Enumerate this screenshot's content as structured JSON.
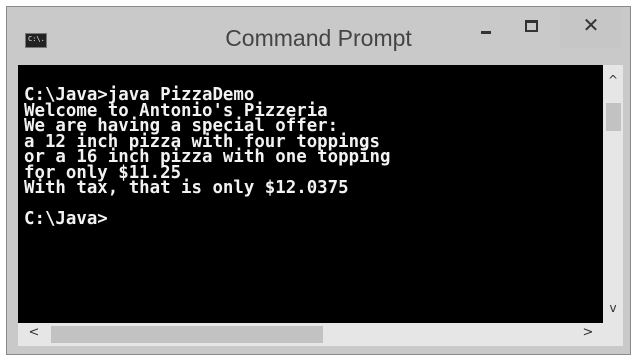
{
  "window": {
    "title": "Command Prompt",
    "icon": "console-app-icon",
    "icon_text": "C:\\."
  },
  "controls": {
    "minimize": "minimize-icon",
    "maximize": "maximize-icon",
    "close_glyph": "✕"
  },
  "console": {
    "lines": [
      "C:\\Java>java PizzaDemo",
      "Welcome to Antonio's Pizzeria",
      "We are having a special offer:",
      "a 12 inch pizza with four toppings",
      "or a 16 inch pizza with one topping",
      "for only $11.25",
      "With tax, that is only $12.0375",
      "",
      "C:\\Java>"
    ],
    "text": "C:\\Java>java PizzaDemo\nWelcome to Antonio's Pizzeria\nWe are having a special offer:\na 12 inch pizza with four toppings\nor a 16 inch pizza with one topping\nfor only $11.25\nWith tax, that is only $12.0375\n\nC:\\Java>",
    "background": "#000000",
    "foreground": "#f2f2f2"
  },
  "scrollbars": {
    "up_arrow": "^",
    "down_arrow": "v",
    "left_arrow": "<",
    "right_arrow": ">"
  }
}
